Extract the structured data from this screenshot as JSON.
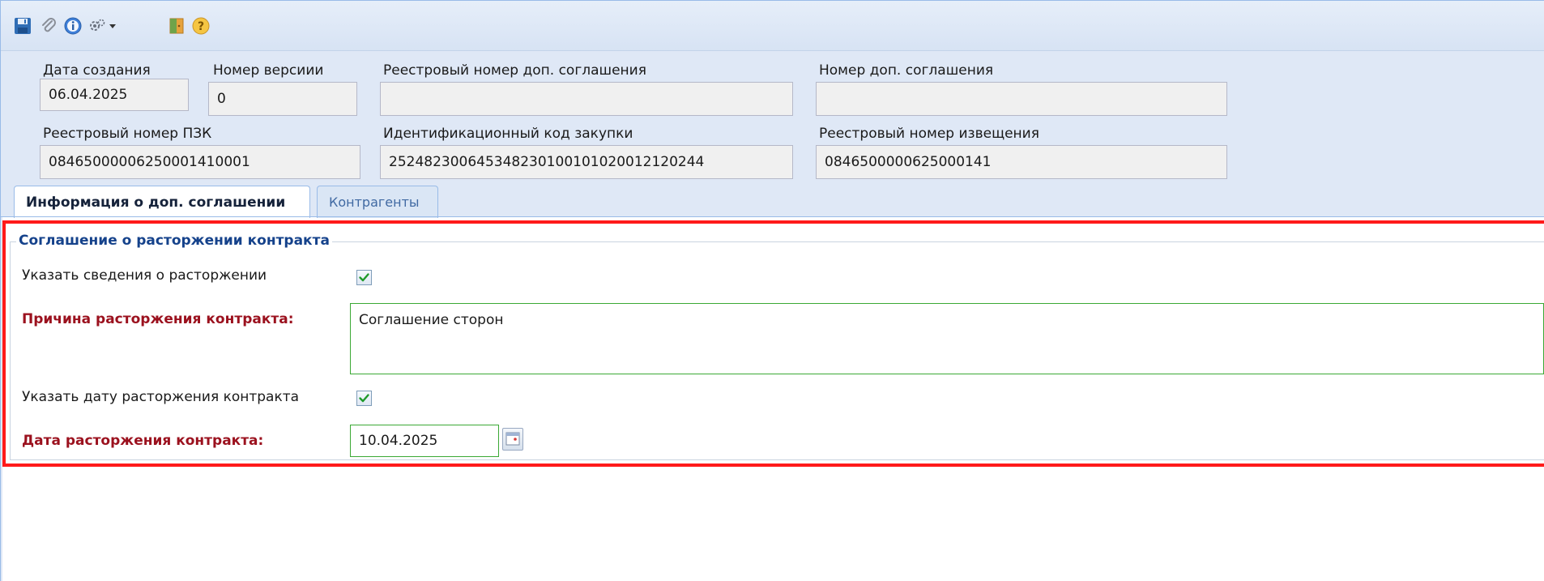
{
  "toolbar": {
    "icons": [
      "save-icon",
      "attach-icon",
      "info-icon",
      "settings-icon",
      "dropdown-arrow-icon",
      "exit-icon",
      "help-icon"
    ]
  },
  "header": {
    "creation_date": {
      "label": "Дата создания",
      "value": "06.04.2025"
    },
    "version_number": {
      "label": "Номер версиии",
      "value": "0"
    },
    "registry_number_agreement": {
      "label": "Реестровый номер доп. соглашения",
      "value": ""
    },
    "agreement_number": {
      "label": "Номер доп. соглашения",
      "value": ""
    },
    "registry_number_pzk": {
      "label": "Реестровый номер ПЗК",
      "value": "08465000006250001410001"
    },
    "purchase_id_code": {
      "label": "Идентификационный код закупки",
      "value": "252482300645348230100101020012120244"
    },
    "notice_registry_number": {
      "label": "Реестровый номер извещения",
      "value": "0846500000625000141"
    }
  },
  "tabs": [
    {
      "label": "Информация о доп. соглашении",
      "active": true
    },
    {
      "label": "Контрагенты",
      "active": false
    }
  ],
  "termination": {
    "section_title": "Соглашение о расторжении контракта",
    "specify_info_label": "Указать сведения о расторжении",
    "specify_info_checked": true,
    "reason_label": "Причина расторжения контракта:",
    "reason_value": "Соглашение сторон",
    "specify_date_label": "Указать дату расторжения контракта",
    "specify_date_checked": true,
    "date_label": "Дата расторжения контракта:",
    "date_value": "10.04.2025"
  },
  "colors": {
    "header_bg": "#dfe8f6",
    "required_label": "#9b111e",
    "section_title": "#15428b",
    "highlight_frame": "#ff1a1a",
    "valid_border": "#3ba935"
  }
}
